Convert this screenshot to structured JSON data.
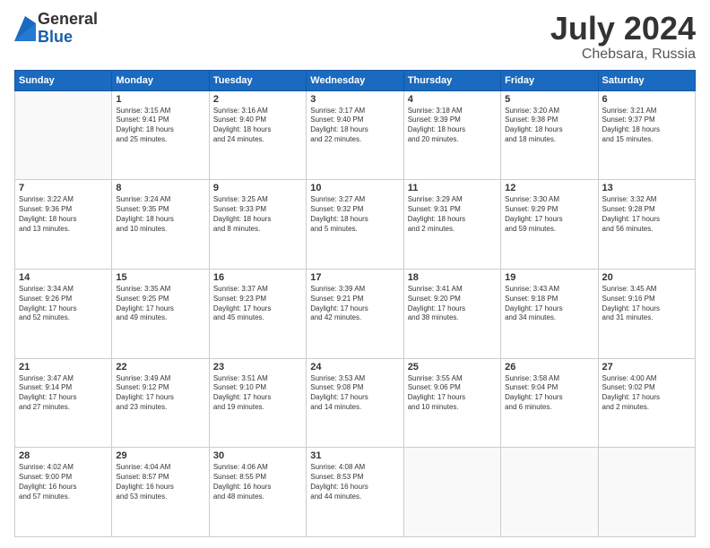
{
  "logo": {
    "general": "General",
    "blue": "Blue"
  },
  "title": {
    "month_year": "July 2024",
    "location": "Chebsara, Russia"
  },
  "headers": [
    "Sunday",
    "Monday",
    "Tuesday",
    "Wednesday",
    "Thursday",
    "Friday",
    "Saturday"
  ],
  "weeks": [
    [
      {
        "day": "",
        "info": ""
      },
      {
        "day": "1",
        "info": "Sunrise: 3:15 AM\nSunset: 9:41 PM\nDaylight: 18 hours\nand 25 minutes."
      },
      {
        "day": "2",
        "info": "Sunrise: 3:16 AM\nSunset: 9:40 PM\nDaylight: 18 hours\nand 24 minutes."
      },
      {
        "day": "3",
        "info": "Sunrise: 3:17 AM\nSunset: 9:40 PM\nDaylight: 18 hours\nand 22 minutes."
      },
      {
        "day": "4",
        "info": "Sunrise: 3:18 AM\nSunset: 9:39 PM\nDaylight: 18 hours\nand 20 minutes."
      },
      {
        "day": "5",
        "info": "Sunrise: 3:20 AM\nSunset: 9:38 PM\nDaylight: 18 hours\nand 18 minutes."
      },
      {
        "day": "6",
        "info": "Sunrise: 3:21 AM\nSunset: 9:37 PM\nDaylight: 18 hours\nand 15 minutes."
      }
    ],
    [
      {
        "day": "7",
        "info": "Sunrise: 3:22 AM\nSunset: 9:36 PM\nDaylight: 18 hours\nand 13 minutes."
      },
      {
        "day": "8",
        "info": "Sunrise: 3:24 AM\nSunset: 9:35 PM\nDaylight: 18 hours\nand 10 minutes."
      },
      {
        "day": "9",
        "info": "Sunrise: 3:25 AM\nSunset: 9:33 PM\nDaylight: 18 hours\nand 8 minutes."
      },
      {
        "day": "10",
        "info": "Sunrise: 3:27 AM\nSunset: 9:32 PM\nDaylight: 18 hours\nand 5 minutes."
      },
      {
        "day": "11",
        "info": "Sunrise: 3:29 AM\nSunset: 9:31 PM\nDaylight: 18 hours\nand 2 minutes."
      },
      {
        "day": "12",
        "info": "Sunrise: 3:30 AM\nSunset: 9:29 PM\nDaylight: 17 hours\nand 59 minutes."
      },
      {
        "day": "13",
        "info": "Sunrise: 3:32 AM\nSunset: 9:28 PM\nDaylight: 17 hours\nand 56 minutes."
      }
    ],
    [
      {
        "day": "14",
        "info": "Sunrise: 3:34 AM\nSunset: 9:26 PM\nDaylight: 17 hours\nand 52 minutes."
      },
      {
        "day": "15",
        "info": "Sunrise: 3:35 AM\nSunset: 9:25 PM\nDaylight: 17 hours\nand 49 minutes."
      },
      {
        "day": "16",
        "info": "Sunrise: 3:37 AM\nSunset: 9:23 PM\nDaylight: 17 hours\nand 45 minutes."
      },
      {
        "day": "17",
        "info": "Sunrise: 3:39 AM\nSunset: 9:21 PM\nDaylight: 17 hours\nand 42 minutes."
      },
      {
        "day": "18",
        "info": "Sunrise: 3:41 AM\nSunset: 9:20 PM\nDaylight: 17 hours\nand 38 minutes."
      },
      {
        "day": "19",
        "info": "Sunrise: 3:43 AM\nSunset: 9:18 PM\nDaylight: 17 hours\nand 34 minutes."
      },
      {
        "day": "20",
        "info": "Sunrise: 3:45 AM\nSunset: 9:16 PM\nDaylight: 17 hours\nand 31 minutes."
      }
    ],
    [
      {
        "day": "21",
        "info": "Sunrise: 3:47 AM\nSunset: 9:14 PM\nDaylight: 17 hours\nand 27 minutes."
      },
      {
        "day": "22",
        "info": "Sunrise: 3:49 AM\nSunset: 9:12 PM\nDaylight: 17 hours\nand 23 minutes."
      },
      {
        "day": "23",
        "info": "Sunrise: 3:51 AM\nSunset: 9:10 PM\nDaylight: 17 hours\nand 19 minutes."
      },
      {
        "day": "24",
        "info": "Sunrise: 3:53 AM\nSunset: 9:08 PM\nDaylight: 17 hours\nand 14 minutes."
      },
      {
        "day": "25",
        "info": "Sunrise: 3:55 AM\nSunset: 9:06 PM\nDaylight: 17 hours\nand 10 minutes."
      },
      {
        "day": "26",
        "info": "Sunrise: 3:58 AM\nSunset: 9:04 PM\nDaylight: 17 hours\nand 6 minutes."
      },
      {
        "day": "27",
        "info": "Sunrise: 4:00 AM\nSunset: 9:02 PM\nDaylight: 17 hours\nand 2 minutes."
      }
    ],
    [
      {
        "day": "28",
        "info": "Sunrise: 4:02 AM\nSunset: 9:00 PM\nDaylight: 16 hours\nand 57 minutes."
      },
      {
        "day": "29",
        "info": "Sunrise: 4:04 AM\nSunset: 8:57 PM\nDaylight: 16 hours\nand 53 minutes."
      },
      {
        "day": "30",
        "info": "Sunrise: 4:06 AM\nSunset: 8:55 PM\nDaylight: 16 hours\nand 48 minutes."
      },
      {
        "day": "31",
        "info": "Sunrise: 4:08 AM\nSunset: 8:53 PM\nDaylight: 16 hours\nand 44 minutes."
      },
      {
        "day": "",
        "info": ""
      },
      {
        "day": "",
        "info": ""
      },
      {
        "day": "",
        "info": ""
      }
    ]
  ]
}
